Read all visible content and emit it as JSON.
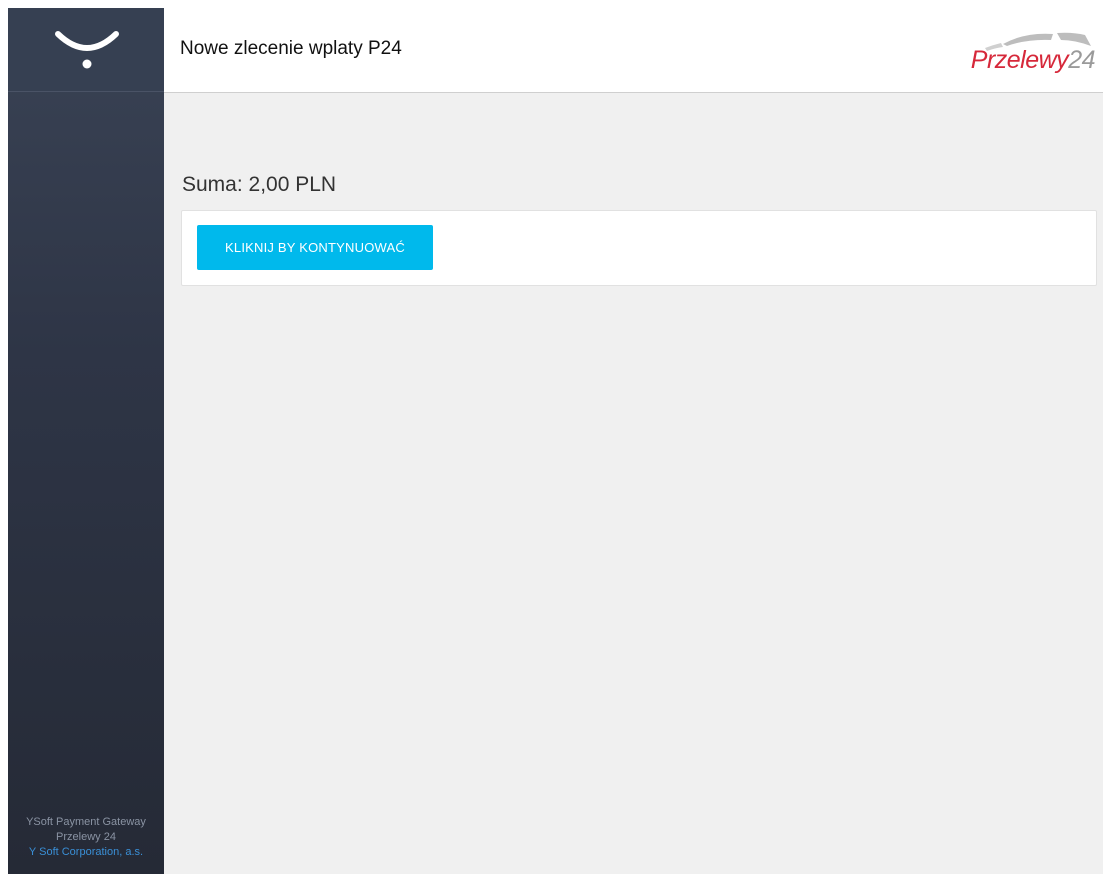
{
  "sidebar": {
    "logo_icon": "ysoft-smile-logo-icon",
    "footer": {
      "line1": "YSoft Payment Gateway",
      "line2": "Przelewy 24",
      "link": "Y Soft Corporation, a.s."
    }
  },
  "header": {
    "title": "Nowe zlecenie wplaty P24",
    "brand_logo": {
      "text_red": "Przelewy",
      "text_grey": "24"
    }
  },
  "main": {
    "sum_label": "Suma: 2,00 PLN",
    "continue_button": "KLIKNIJ BY KONTYNUOWAĆ"
  },
  "colors": {
    "sidebar": "#2e3546",
    "accent_button": "#00b9ec",
    "brand_red": "#d6283a",
    "link_blue": "#3a8fd6",
    "background": "#f0f0f0"
  }
}
